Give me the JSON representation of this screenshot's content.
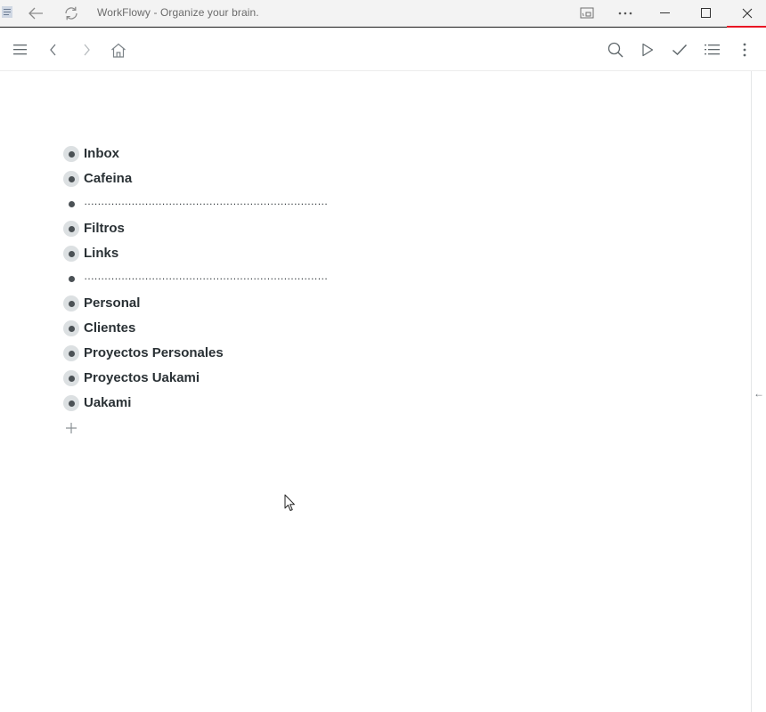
{
  "window": {
    "title": "WorkFlowy - Organize your brain.",
    "close_accent": "#e81123"
  },
  "titlebar_icons": {
    "app": "app-icon",
    "back": "arrow-left-icon",
    "refresh": "refresh-icon",
    "cast": "cast-icon",
    "more": "more-horizontal-icon",
    "minimize": "minimize-icon",
    "maximize": "maximize-icon",
    "close": "close-icon"
  },
  "toolbar": {
    "left": [
      "menu-icon",
      "chevron-left-icon",
      "chevron-right-icon",
      "home-icon"
    ],
    "right": [
      "search-icon",
      "play-icon",
      "check-icon",
      "list-icon",
      "more-vertical-icon"
    ]
  },
  "outline": {
    "items": [
      {
        "label": "Inbox",
        "kind": "collapsed"
      },
      {
        "label": "Cafeina",
        "kind": "collapsed"
      },
      {
        "label": "………………………………………………………………",
        "kind": "divider"
      },
      {
        "label": "Filtros",
        "kind": "collapsed"
      },
      {
        "label": "Links",
        "kind": "collapsed"
      },
      {
        "label": "………………………………………………………………",
        "kind": "divider"
      },
      {
        "label": "Personal",
        "kind": "collapsed"
      },
      {
        "label": "Clientes",
        "kind": "collapsed"
      },
      {
        "label": "Proyectos Personales",
        "kind": "collapsed"
      },
      {
        "label": "Proyectos Uakami",
        "kind": "collapsed"
      },
      {
        "label": "Uakami",
        "kind": "collapsed"
      }
    ],
    "add_icon": "plus-icon"
  },
  "rail": {
    "arrow": "←"
  }
}
